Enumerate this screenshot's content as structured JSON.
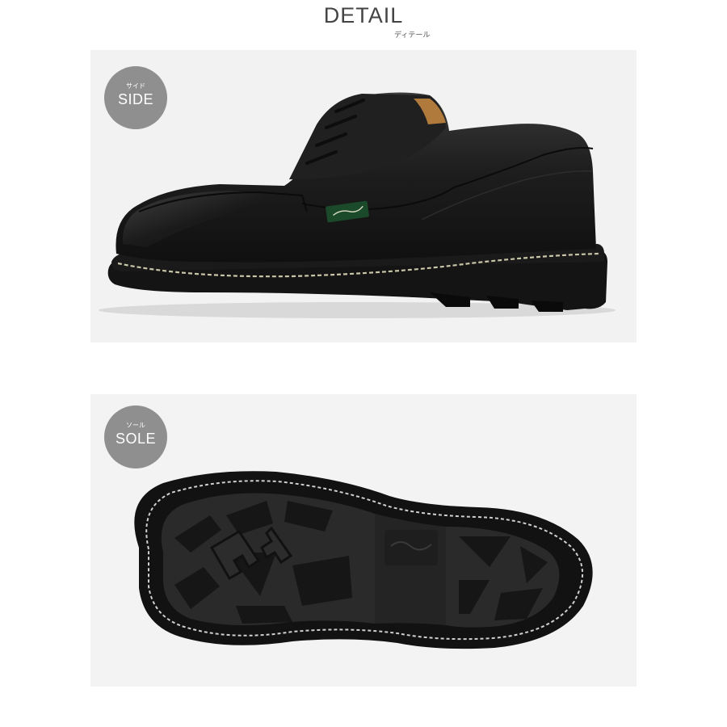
{
  "header": {
    "title": "DETAIL",
    "subtitle": "ディテール"
  },
  "panels": [
    {
      "badge_sub": "サイド",
      "badge_label": "SIDE"
    },
    {
      "badge_sub": "ソール",
      "badge_label": "SOLE"
    }
  ],
  "colors": {
    "badge": "#8f8f8f",
    "leather": "#1c1c1c",
    "sole": "#151515",
    "stitching": "#c9c6a8",
    "heading": "#444444"
  }
}
